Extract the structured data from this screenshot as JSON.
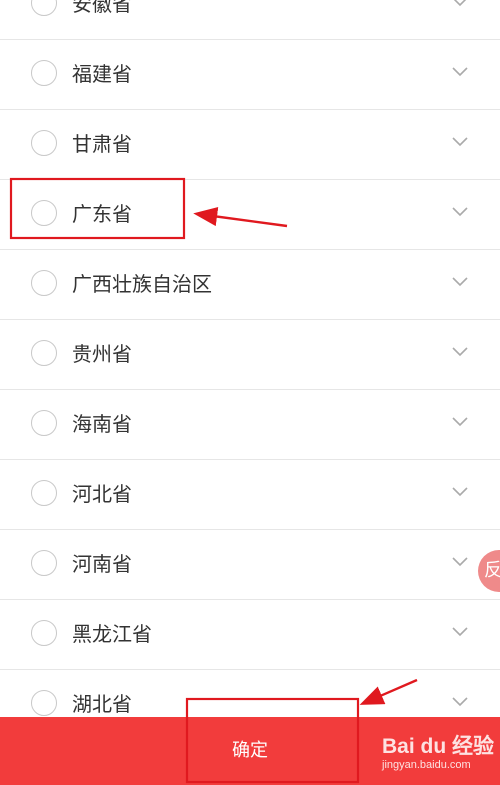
{
  "provinces": [
    {
      "label": "安徽省"
    },
    {
      "label": "福建省"
    },
    {
      "label": "甘肃省"
    },
    {
      "label": "广东省"
    },
    {
      "label": "广西壮族自治区"
    },
    {
      "label": "贵州省"
    },
    {
      "label": "海南省"
    },
    {
      "label": "河北省"
    },
    {
      "label": "河南省"
    },
    {
      "label": "黑龙江省"
    },
    {
      "label": "湖北省"
    }
  ],
  "footer": {
    "confirm_label": "确定"
  },
  "watermark": {
    "main": "Bai du 经验",
    "sub": "jingyan.baidu.com"
  },
  "floating": {
    "label": "反"
  },
  "colors": {
    "accent": "#f23c3c",
    "annotation": "#e0191f",
    "radio_border": "#c9c9c9",
    "divider": "#e6e6e6",
    "text": "#333333"
  },
  "icons": {
    "row_select": "radio-circle-icon",
    "row_expand": "chevron-down-icon"
  }
}
